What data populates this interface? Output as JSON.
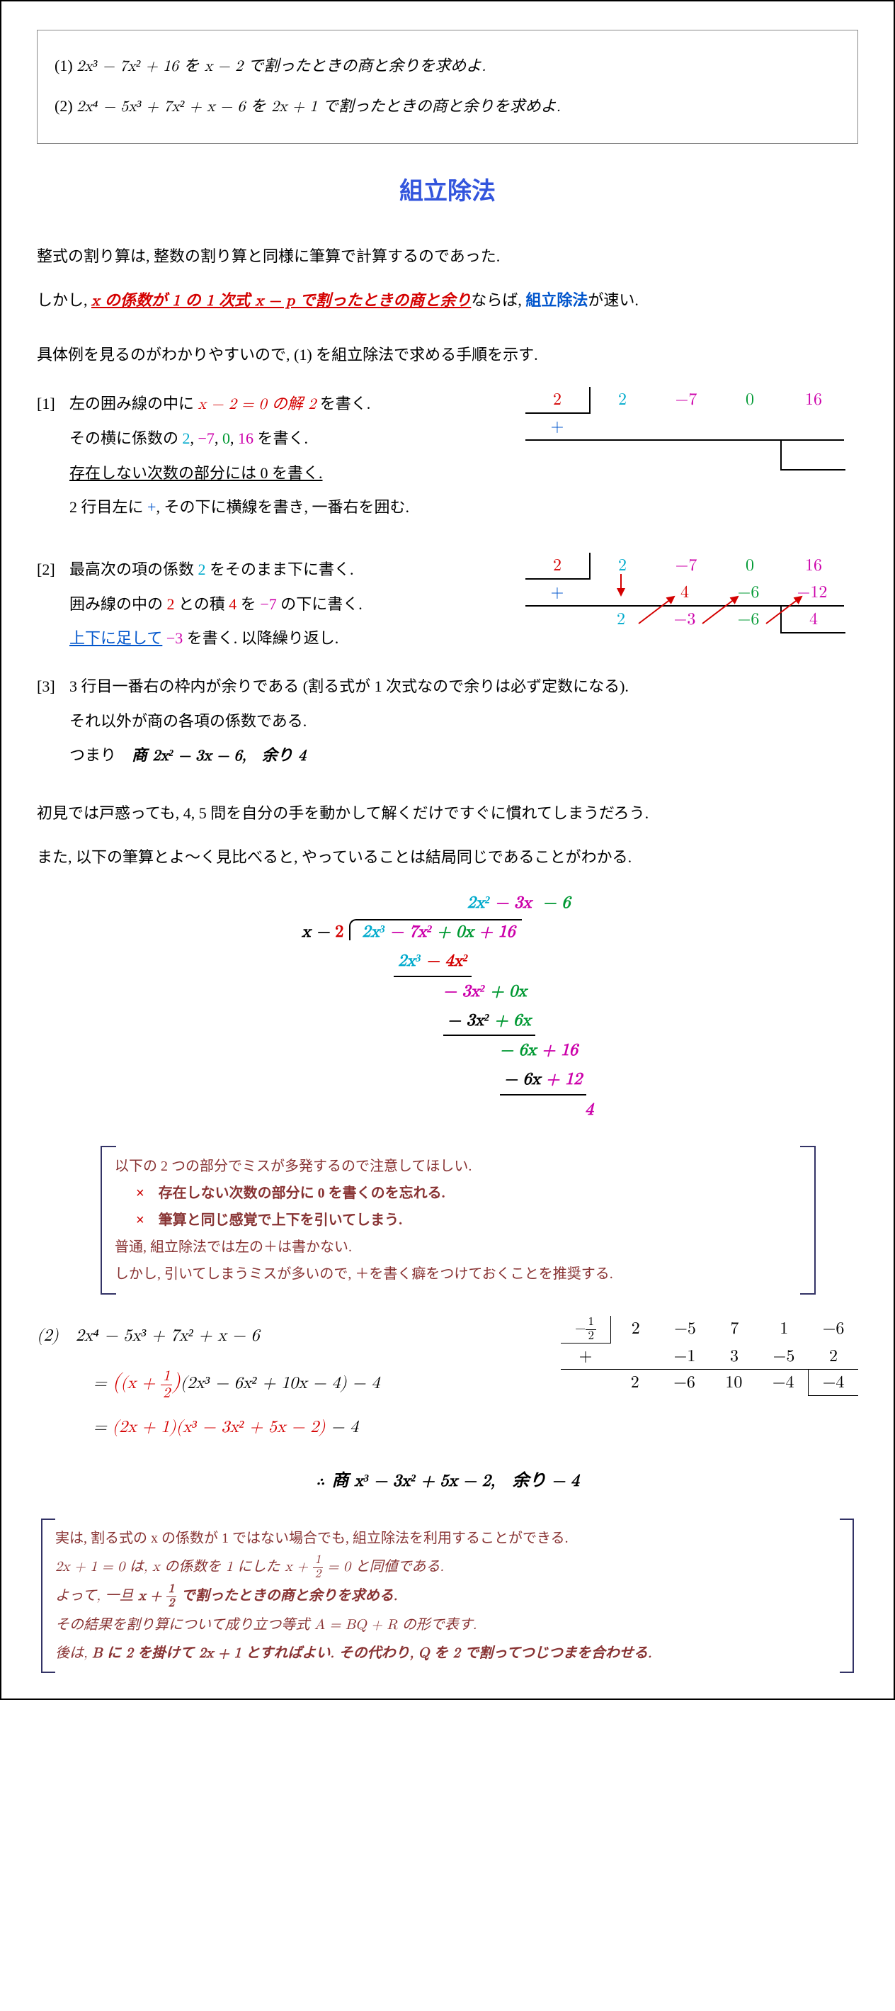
{
  "questions": {
    "q1_label": "(1)",
    "q1_body": "2x³ − 7x² + 16 を x − 2 で割ったときの商と余りを求めよ.",
    "q2_label": "(2)",
    "q2_body": "2x⁴ − 5x³ + 7x² + x − 6 を 2x + 1 で割ったときの商と余りを求めよ."
  },
  "title": "組立除法",
  "intro": {
    "p1": "整式の割り算は, 整数の割り算と同様に筆算で計算するのであった.",
    "p2a": "しかし, ",
    "p2b": "x の係数が 1 の 1 次式 x − p で割ったときの商と余り",
    "p2c": "ならば, ",
    "p2d": "組立除法",
    "p2e": "が速い.",
    "p3": "具体例を見るのがわかりやすいので, (1) を組立除法で求める手順を示す."
  },
  "step1": {
    "label": "[1]",
    "l1a": "左の囲み線の中に ",
    "l1b": "x − 2 = 0 の解 2",
    "l1c": " を書く.",
    "l2a": "その横に係数の ",
    "c2": "2",
    "c_7": "−7",
    "c0": "0",
    "c16": "16",
    "l2b": " を書く.",
    "l3": "存在しない次数の部分には 0 を書く.",
    "l4a": "2 行目左に ",
    "plus": "+",
    "l4b": ", その下に横線を書き, 一番右を囲む."
  },
  "step2": {
    "label": "[2]",
    "l1a": "最高次の項の係数 ",
    "c2": "2",
    "l1b": " をそのまま下に書く.",
    "l2a": "囲み線の中の ",
    "root2": "2",
    "l2b": " との積 ",
    "prod4": "4",
    "l2c": " を ",
    "neg7": "−7",
    "l2d": " の下に書く.",
    "l3a": "上下に足して",
    "l3b": " ",
    "neg3": "−3",
    "l3c": " を書く. 以降繰り返し.",
    "row1": {
      "a": "2",
      "b": "2",
      "c": "−7",
      "d": "0",
      "e": "16"
    },
    "row2": {
      "a": "+",
      "b": "",
      "c": "4",
      "d": "−6",
      "e": "−12"
    },
    "row3": {
      "a": "",
      "b": "2",
      "c": "−3",
      "d": "−6",
      "e": "4"
    }
  },
  "step3": {
    "label": "[3]",
    "l1": "3 行目一番右の枠内が余りである (割る式が 1 次式なので余りは必ず定数になる).",
    "l2": "それ以外が商の各項の係数である.",
    "l3a": "つまり　",
    "l3b": "商 2x² − 3x − 6,　余り 4"
  },
  "bridge": {
    "p1": "初見では戸惑っても, 4, 5 問を自分の手を動かして解くだけですぐに慣れてしまうだろう.",
    "p2": "また, 以下の筆算とよ〜く見比べると, やっていることは結局同じであることがわかる."
  },
  "longdiv": {
    "quotient": {
      "a": "2x²",
      "b": " − 3x",
      "c": "  − 6"
    },
    "divisor": "x − 2",
    "dividend": {
      "a": "2x³",
      "b": " − 7x²",
      "c": " + 0x",
      "d": " + 16"
    },
    "r1": {
      "a": "2x³",
      "b": " − 4x²"
    },
    "r2": {
      "a": "− 3x²",
      "b": " + 0x"
    },
    "r3": {
      "a": "− 3x²",
      "b": " + 6x"
    },
    "r4": {
      "a": "− 6x",
      "b": " + 16"
    },
    "r5": {
      "a": "− 6x",
      "b": " + 12"
    },
    "rem": "4"
  },
  "warn": {
    "head": "以下の 2 つの部分でミスが多発するので注意してほしい.",
    "x1": "存在しない次数の部分に 0 を書くのを忘れる.",
    "x2": "筆算と同じ感覚で上下を引いてしまう.",
    "foot1": "普通, 組立除法では左の＋は書かない.",
    "foot2": "しかし, 引いてしまうミスが多いので, ＋を書く癖をつけておくことを推奨する."
  },
  "sol2": {
    "label": "(2)",
    "line0": "2x⁴ − 5x³ + 7x² + x − 6",
    "line1a": "= ",
    "line1b": "(x + ",
    "line1c": ")",
    "line1d": "(2x³ − 6x² + 10x − 4) − 4",
    "line2a": "= ",
    "line2b": "(2x + 1)(x³ − 3x² + 5x − 2)",
    "line2c": " − 4",
    "half_n": "1",
    "half_d": "2",
    "table": {
      "root": "−½",
      "r1": [
        "2",
        "−5",
        "7",
        "1",
        "−6"
      ],
      "r2": [
        "+",
        "−1",
        "3",
        "−5",
        "2"
      ],
      "r3": [
        "",
        "2",
        "−6",
        "10",
        "−4",
        "−4"
      ]
    },
    "conclusion": "商 x³ − 3x² + 5x − 2,　余り − 4"
  },
  "final": {
    "p1": "実は, 割る式の x の係数が 1 ではない場合でも, 組立除法を利用することができる.",
    "p2a": "2x + 1 = 0 は, x の係数を 1 にした x + ",
    "p2b": " = 0 と同値である.",
    "p3a": "よって, 一旦 ",
    "p3b": "x + ",
    "p3c": " で割ったときの商と余りを求める.",
    "p4": "その結果を割り算について成り立つ等式 A = BQ + R の形で表す.",
    "p5a": "後は, ",
    "p5b": "B に 2 を掛けて 2x + 1 とすればよい. その代わり, Q を 2 で割ってつじつまを合わせる."
  }
}
